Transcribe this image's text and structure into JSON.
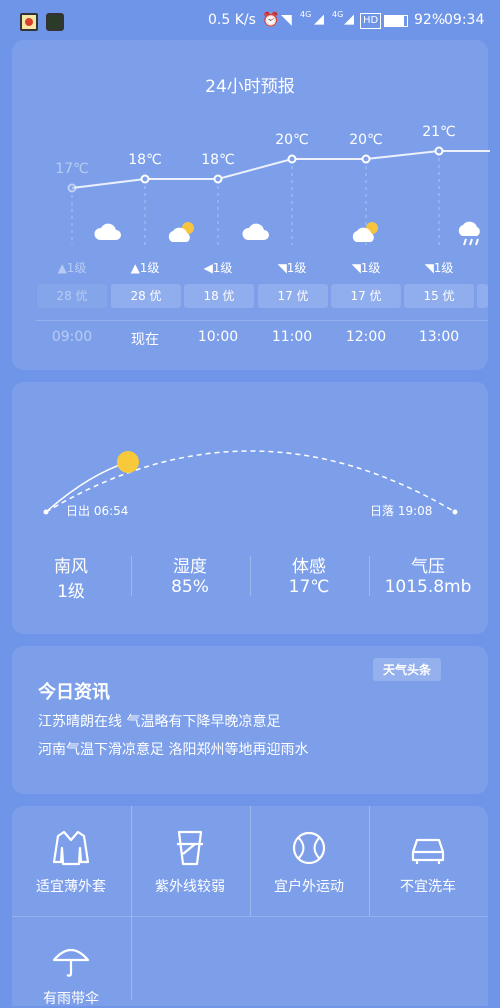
{
  "status_bar": {
    "speed": "0.5 K/s",
    "net1": "4G",
    "net2": "4G",
    "hd": "HD",
    "battery": "92%",
    "time": "09:34"
  },
  "forecast": {
    "title": "24小时预报",
    "hours": [
      {
        "temp": "17℃",
        "wind": "1级",
        "aqi": "28 优",
        "time": "09:00",
        "icon": "cloud-icon"
      },
      {
        "temp": "18℃",
        "wind": "1级",
        "aqi": "28 优",
        "time": "现在",
        "icon": "partly-cloudy-icon"
      },
      {
        "temp": "18℃",
        "wind": "1级",
        "aqi": "18 优",
        "time": "10:00",
        "icon": "cloud-icon"
      },
      {
        "temp": "20℃",
        "wind": "1级",
        "aqi": "17 优",
        "time": "11:00",
        "icon": "partly-cloudy-icon"
      },
      {
        "temp": "20℃",
        "wind": "1级",
        "aqi": "17 优",
        "time": "12:00",
        "icon": "partly-cloudy-icon"
      },
      {
        "temp": "21℃",
        "wind": "1级",
        "aqi": "15 优",
        "time": "13:00",
        "icon": "rain-icon"
      }
    ]
  },
  "sun": {
    "sunrise": "日出 06:54",
    "sunset": "日落 19:08"
  },
  "stats": [
    {
      "label": "南风",
      "value": "1级"
    },
    {
      "label": "湿度",
      "value": "85%"
    },
    {
      "label": "体感",
      "value": "17℃"
    },
    {
      "label": "气压",
      "value": "1015.8mb"
    }
  ],
  "news": {
    "title": "今日资讯",
    "badge": "天气头条",
    "lines": [
      "江苏晴朗在线 气温略有下降早晚凉意足",
      "河南气温下滑凉意足 洛阳郑州等地再迎雨水"
    ]
  },
  "tips": [
    {
      "label": "适宜薄外套",
      "icon": "jacket-icon"
    },
    {
      "label": "紫外线较弱",
      "icon": "cup-icon"
    },
    {
      "label": "宜户外运动",
      "icon": "ball-icon"
    },
    {
      "label": "不宜洗车",
      "icon": "car-icon"
    },
    {
      "label": "有雨带伞",
      "icon": "umbrella-icon"
    }
  ]
}
